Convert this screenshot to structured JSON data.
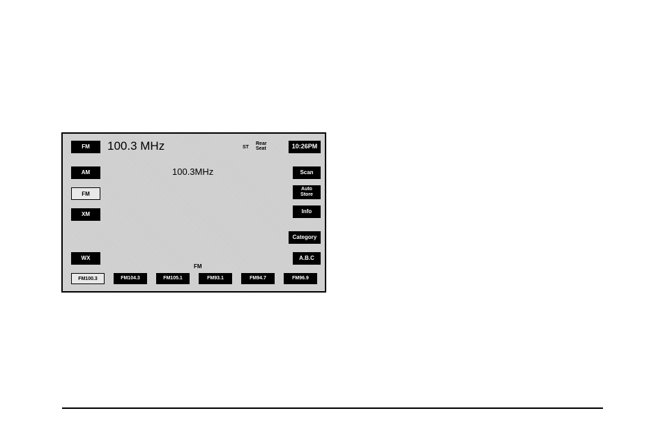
{
  "left": {
    "fm_top": "FM",
    "am": "AM",
    "fm_selected": "FM",
    "xm": "XM",
    "wx": "WX"
  },
  "right": {
    "clock": "10:26PM",
    "scan": "Scan",
    "auto_store": "Auto\nStore",
    "info": "Info",
    "category": "Category",
    "abc": "A.B.C"
  },
  "center": {
    "freq_main": "100.3 MHz",
    "st": "ST",
    "rear_seat": "Rear\nSeat",
    "freq_center": "100.3MHz",
    "band": "FM"
  },
  "presets": [
    "FM100.3",
    "FM104.3",
    "FM105.1",
    "FM93.1",
    "FM94.7",
    "FM96.9"
  ]
}
